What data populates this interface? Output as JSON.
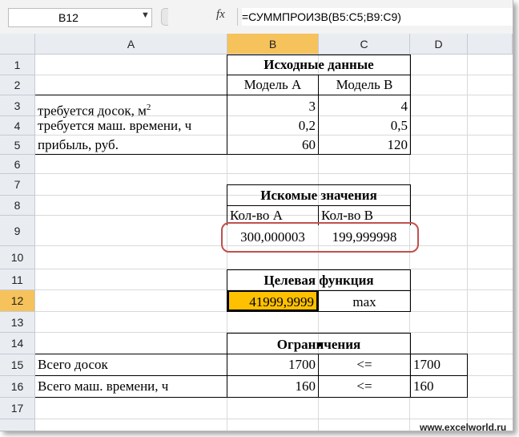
{
  "formula_bar": {
    "name_box": "B12",
    "fx_label": "fx",
    "formula": "=СУММПРОИЗВ(B5:C5;B9:C9)"
  },
  "columns": [
    "A",
    "B",
    "C",
    "D"
  ],
  "rows": [
    "1",
    "2",
    "3",
    "4",
    "5",
    "6",
    "7",
    "8",
    "9",
    "10",
    "11",
    "12",
    "13",
    "14",
    "15",
    "16",
    "17"
  ],
  "selected_cell": "B12",
  "cells": {
    "B1": "Исходные данные",
    "B2": "Модель А",
    "C2": "Модель В",
    "A3": "требуется досок, м",
    "A3_sup": "2",
    "B3": "3",
    "C3": "4",
    "A4": "требуется маш. времени, ч",
    "B4": "0,2",
    "C4": "0,5",
    "A5": "прибыль, руб.",
    "B5": "60",
    "C5": "120",
    "B7": "Искомые значения",
    "B8": "Кол-во А",
    "C8": "Кол-во В",
    "B9": "300,000003",
    "C9": "199,999998",
    "B11": "Целевая функция",
    "B12": "41999,9999",
    "C12": "max",
    "B14": "Ограничения",
    "A15": "Всего досок",
    "B15": "1700",
    "C15": "<=",
    "D15": "1700",
    "A16": "Всего маш. времени, ч",
    "B16": "160",
    "C16": "<=",
    "D16": "160"
  },
  "watermark": "www.excelworld.ru",
  "colors": {
    "selected_fill": "#ffc000",
    "highlight_oval": "#c0504d",
    "header_bg": "#e9edf2"
  }
}
